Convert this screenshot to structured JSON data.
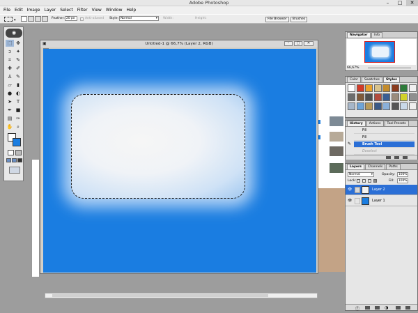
{
  "app": {
    "title": "Adobe Photoshop",
    "min": "–",
    "max": "□",
    "close": "✕"
  },
  "menu": [
    "File",
    "Edit",
    "Image",
    "Layer",
    "Select",
    "Filter",
    "View",
    "Window",
    "Help"
  ],
  "options": {
    "feather_label": "Feather:",
    "feather_value": "20 px",
    "antialiased_label": "Anti-aliased",
    "style_label": "Style:",
    "style_value": "Normal",
    "width_label": "Width:",
    "height_label": "Height:",
    "file_browser": "File Browser",
    "brushes": "Brushes"
  },
  "document": {
    "title": "Untitled-1 @ 66,7% (Layer 2, RGB)",
    "canvas_color": "#1a7de1"
  },
  "navigator": {
    "tabs": [
      "Navigator",
      "Info"
    ],
    "zoom": "66,67%"
  },
  "styles_panel": {
    "tabs": [
      "Color",
      "Swatches",
      "Styles"
    ],
    "swatches": [
      "#ffffff",
      "#d23b28",
      "#e8a22c",
      "#d8c28a",
      "#c38b2b",
      "#8a3c1e",
      "#2d7a3a",
      "#f0f0f0",
      "#6d6d6d",
      "#7f5a3a",
      "#4f4f4f",
      "#b24b3d",
      "#3a5e93",
      "#9b8c7c",
      "#d1d12a",
      "#8f8f8f",
      "#a6b6c9",
      "#6ea4d8",
      "#b89a5a",
      "#3b5a86",
      "#8ab0d9",
      "#555555",
      "#c9d8e8",
      "#eeeeee"
    ]
  },
  "history": {
    "tabs": [
      "History",
      "Actions",
      "Tool Presets"
    ],
    "items": [
      {
        "label": "Fill",
        "state": "normal"
      },
      {
        "label": "Fill",
        "state": "normal"
      },
      {
        "label": "Brush Tool",
        "state": "selected"
      },
      {
        "label": "Deselect",
        "state": "dimmed"
      }
    ]
  },
  "layers": {
    "tabs": [
      "Layers",
      "Channels",
      "Paths"
    ],
    "blend_mode": "Normal",
    "opacity_label": "Opacity:",
    "opacity_value": "100%",
    "lock_label": "Lock:",
    "fill_label": "Fill:",
    "fill_value": "100%",
    "items": [
      {
        "name": "Layer 2",
        "selected": true,
        "thumb": "#f2f2f2"
      },
      {
        "name": "Layer 1",
        "selected": false,
        "thumb": "#1a7de1"
      }
    ]
  },
  "colors": {
    "selection": "#2b6fd6",
    "foreground": "#ffffff",
    "background": "#1a7de1"
  }
}
